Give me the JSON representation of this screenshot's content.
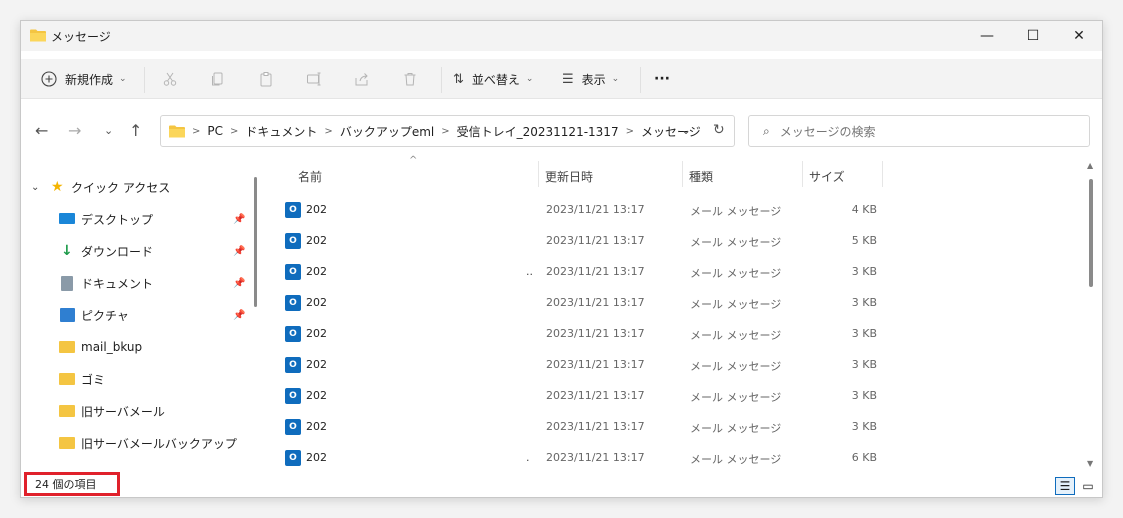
{
  "window": {
    "title": "メッセージ",
    "controls": {
      "minimize": "—",
      "maximize": "☐",
      "close": "✕"
    }
  },
  "toolbar": {
    "new_label": "新規作成",
    "sort_label": "並べ替え",
    "view_label": "表示",
    "more_label": "···"
  },
  "address": {
    "crumbs": [
      "PC",
      "ドキュメント",
      "バックアップeml",
      "受信トレイ_20231121-1317",
      "メッセージ"
    ],
    "search_placeholder": "メッセージの検索"
  },
  "sidebar": {
    "quick_access": "クイック アクセス",
    "items": [
      {
        "label": "デスクトップ",
        "icon": "desktop-icon",
        "pinned": true
      },
      {
        "label": "ダウンロード",
        "icon": "download-icon",
        "pinned": true
      },
      {
        "label": "ドキュメント",
        "icon": "document-icon",
        "pinned": true
      },
      {
        "label": "ピクチャ",
        "icon": "picture-icon",
        "pinned": true
      },
      {
        "label": "mail_bkup",
        "icon": "folder-icon",
        "pinned": false
      },
      {
        "label": "ゴミ",
        "icon": "folder-icon",
        "pinned": false
      },
      {
        "label": "旧サーバメール",
        "icon": "folder-icon",
        "pinned": false
      },
      {
        "label": "旧サーバメールバックアップ",
        "icon": "folder-icon",
        "pinned": false
      }
    ]
  },
  "columns": {
    "name": "名前",
    "modified": "更新日時",
    "type": "種類",
    "size": "サイズ"
  },
  "files": [
    {
      "name": "202",
      "extra": "",
      "modified": "2023/11/21 13:17",
      "type": "メール メッセージ",
      "size": "4 KB"
    },
    {
      "name": "202",
      "extra": "",
      "modified": "2023/11/21 13:17",
      "type": "メール メッセージ",
      "size": "5 KB"
    },
    {
      "name": "202",
      "extra": "..",
      "modified": "2023/11/21 13:17",
      "type": "メール メッセージ",
      "size": "3 KB"
    },
    {
      "name": "202",
      "extra": "",
      "modified": "2023/11/21 13:17",
      "type": "メール メッセージ",
      "size": "3 KB"
    },
    {
      "name": "202",
      "extra": "",
      "modified": "2023/11/21 13:17",
      "type": "メール メッセージ",
      "size": "3 KB"
    },
    {
      "name": "202",
      "extra": "",
      "modified": "2023/11/21 13:17",
      "type": "メール メッセージ",
      "size": "3 KB"
    },
    {
      "name": "202",
      "extra": "",
      "modified": "2023/11/21 13:17",
      "type": "メール メッセージ",
      "size": "3 KB"
    },
    {
      "name": "202",
      "extra": "",
      "modified": "2023/11/21 13:17",
      "type": "メール メッセージ",
      "size": "3 KB"
    },
    {
      "name": "202",
      "extra": ".",
      "modified": "2023/11/21 13:17",
      "type": "メール メッセージ",
      "size": "6 KB"
    }
  ],
  "status": {
    "item_count": "24 個の項目"
  },
  "colors": {
    "accent": "#0f6cbd",
    "highlight_box": "#e0212b",
    "folder": "#f4c542"
  }
}
